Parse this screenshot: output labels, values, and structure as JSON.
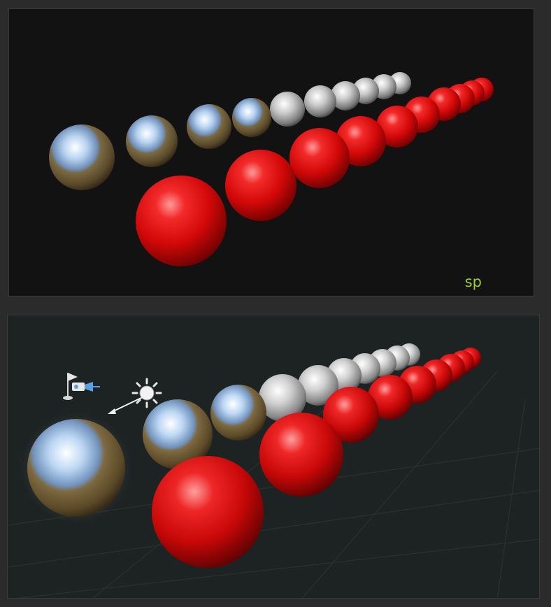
{
  "viewports": {
    "top": {
      "renderer_label": "sp",
      "label_color": "#9acd32",
      "background": "#121212"
    },
    "bottom": {
      "background": "#1d2322",
      "grid": true
    }
  },
  "materials": {
    "chrome": {
      "name": "chrome-reflective"
    },
    "red": {
      "name": "glossy-red",
      "color": "#d40a0a"
    }
  },
  "gizmos": [
    "camera-icon",
    "light-sun-icon"
  ],
  "sphere_counts": {
    "top_silver": 10,
    "top_red": 12,
    "bottom_silver": 11,
    "bottom_red": 12
  }
}
